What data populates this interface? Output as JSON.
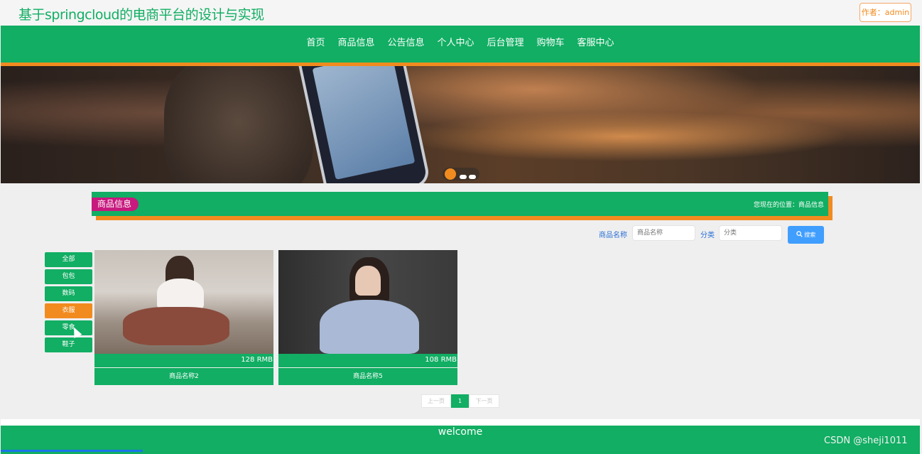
{
  "header": {
    "site_title": "基于springcloud的电商平台的设计与实现",
    "author_label": "作者：admin"
  },
  "nav": {
    "items": [
      "首页",
      "商品信息",
      "公告信息",
      "个人中心",
      "后台管理",
      "购物车",
      "客服中心"
    ]
  },
  "section": {
    "title": "商品信息",
    "breadcrumb": "您现在的位置：商品信息"
  },
  "search": {
    "name_label": "商品名称",
    "name_placeholder": "商品名称",
    "category_label": "分类",
    "category_placeholder": "分类",
    "button_label": "搜索"
  },
  "categories": [
    "全部",
    "包包",
    "数码",
    "衣服",
    "零食",
    "鞋子"
  ],
  "active_category": "衣服",
  "products": [
    {
      "price": "128 RMB",
      "name": "商品名称2"
    },
    {
      "price": "108 RMB",
      "name": "商品名称5"
    }
  ],
  "pagination": {
    "prev": "上一页",
    "current": "1",
    "next": "下一页"
  },
  "footer": {
    "text": "welcome"
  },
  "watermark": "CSDN @sheji1011",
  "colors": {
    "primary": "#11ae63",
    "accent": "#f28b1f",
    "tag": "#c7197e",
    "button": "#409eff"
  }
}
